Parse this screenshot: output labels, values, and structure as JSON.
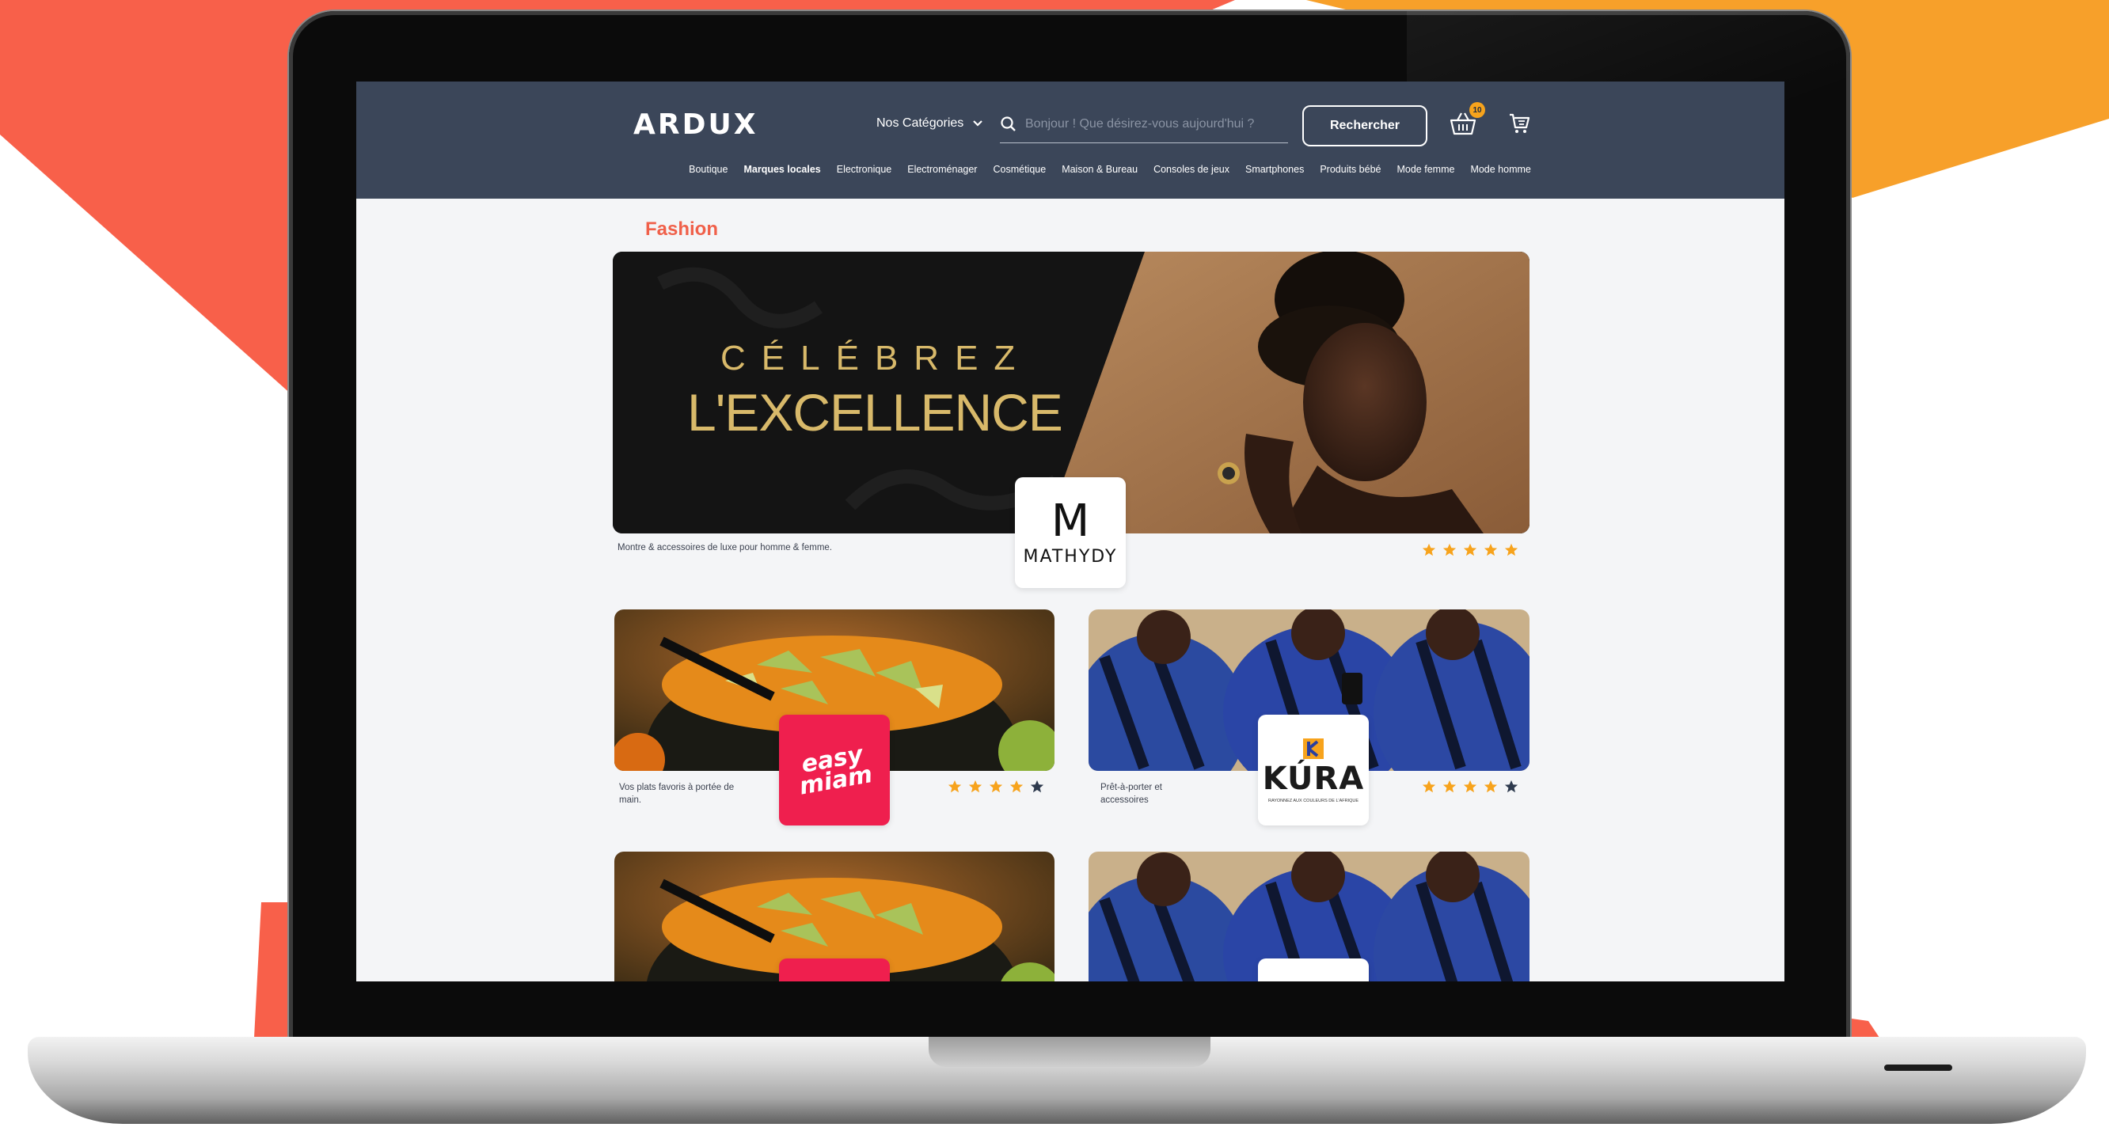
{
  "header": {
    "logo": "ARDUX",
    "categories_label": "Nos Catégories",
    "search_placeholder": "Bonjour ! Que désirez-vous aujourd'hui ?",
    "search_button": "Rechercher",
    "cart_count": "10"
  },
  "nav": {
    "items": [
      {
        "label": "Boutique"
      },
      {
        "label": "Marques locales"
      },
      {
        "label": "Electronique"
      },
      {
        "label": "Electroménager"
      },
      {
        "label": "Cosmétique"
      },
      {
        "label": "Maison & Bureau"
      },
      {
        "label": "Consoles de jeux"
      },
      {
        "label": "Smartphones"
      },
      {
        "label": "Produits bébé"
      },
      {
        "label": "Mode femme"
      },
      {
        "label": "Mode homme"
      }
    ],
    "active": "Marques locales"
  },
  "section": {
    "title": "Fashion"
  },
  "hero": {
    "line1": "CÉLÉBREZ",
    "line2": "L'EXCELLENCE",
    "brand_logo_mark": "M",
    "brand_name": "MATHYDY",
    "description": "Montre & accessoires de luxe pour homme & femme.",
    "rating": 5
  },
  "cards": [
    {
      "brand": "easy miam",
      "logo_line1": "easy",
      "logo_line2": "miam",
      "description": "Vos plats favoris à portée de main.",
      "rating": 4
    },
    {
      "brand": "KURA",
      "logo_name": "KÚRA",
      "logo_tagline": "RAYONNEZ AUX COULEURS DE L'AFRIQUE",
      "description": "Prêt-à-porter et accessoires",
      "rating": 4
    }
  ],
  "colors": {
    "header_bg": "#3b4659",
    "accent": "#f0604a",
    "star_on": "#f7a31c",
    "star_off": "#2e3a4e",
    "easy_miam": "#ef1f4e"
  }
}
